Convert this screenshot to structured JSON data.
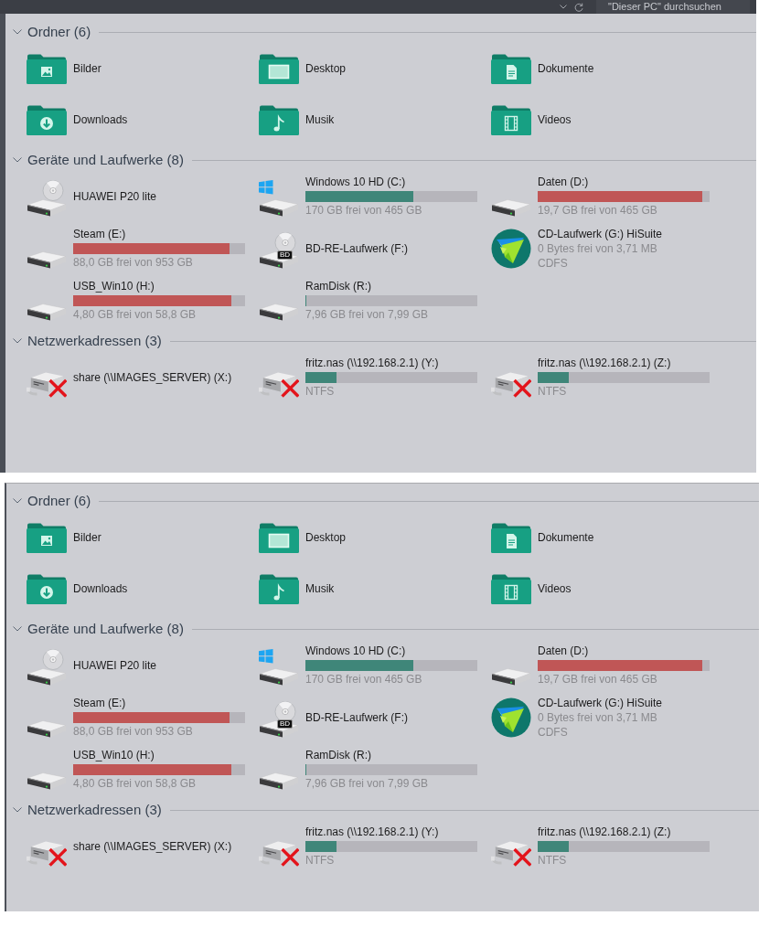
{
  "panels": [
    {
      "toolbar": {
        "search": {
          "placeholder": "\"Dieser PC\" durchsuchen"
        }
      },
      "groups": [
        {
          "title": "Ordner (6)",
          "expanded": true,
          "items": [
            {
              "kind": "pictures",
              "name": "Bilder"
            },
            {
              "kind": "desktop",
              "name": "Desktop"
            },
            {
              "kind": "documents",
              "name": "Dokumente"
            },
            {
              "kind": "downloads",
              "name": "Downloads"
            },
            {
              "kind": "music",
              "name": "Musik"
            },
            {
              "kind": "videos",
              "name": "Videos"
            }
          ]
        },
        {
          "title": "Geräte und Laufwerke (8)",
          "expanded": true,
          "items": [
            {
              "kind": "phone",
              "name": "HUAWEI P20 lite"
            },
            {
              "kind": "system",
              "name": "Windows 10 HD (C:)",
              "level": 0.63,
              "low_space": false,
              "free": "170 GB frei von 465 GB"
            },
            {
              "kind": "disk",
              "name": "Daten (D:)",
              "level": 0.96,
              "low_space": true,
              "free": "19,7 GB frei von 465 GB"
            },
            {
              "kind": "disk",
              "name": "Steam (E:)",
              "level": 0.91,
              "low_space": true,
              "free": "88,0 GB frei von 953 GB"
            },
            {
              "kind": "bluray",
              "name": "BD-RE-Laufwerk (F:)",
              "badge": "BD"
            },
            {
              "kind": "autorun",
              "name": "CD-Laufwerk (G:) HiSuite",
              "free": "0 Bytes frei von 3,71 MB",
              "filesystem": "CDFS"
            },
            {
              "kind": "disk",
              "name": "USB_Win10 (H:)",
              "level": 0.92,
              "low_space": true,
              "free": "4,80 GB frei von 58,8 GB"
            },
            {
              "kind": "disk",
              "name": "RamDisk (R:)",
              "level": 0.004,
              "low_space": false,
              "free": "7,96 GB frei von 7,99 GB"
            }
          ]
        },
        {
          "title": "Netzwerkadressen (3)",
          "expanded": true,
          "items": [
            {
              "kind": "netdrive",
              "name": "share (\\\\IMAGES_SERVER) (X:)",
              "disconnected": true
            },
            {
              "kind": "netdrive",
              "name": "fritz.nas (\\\\192.168.2.1) (Y:)",
              "disconnected": true,
              "level": 0.18,
              "low_space": false,
              "filesystem": "NTFS"
            },
            {
              "kind": "netdrive",
              "name": "fritz.nas (\\\\192.168.2.1) (Z:)",
              "disconnected": true,
              "level": 0.18,
              "low_space": false,
              "filesystem": "NTFS"
            }
          ]
        }
      ]
    },
    {
      "groups": [
        {
          "title": "Ordner (6)",
          "expanded": true,
          "items": [
            {
              "kind": "pictures",
              "name": "Bilder"
            },
            {
              "kind": "desktop",
              "name": "Desktop"
            },
            {
              "kind": "documents",
              "name": "Dokumente"
            },
            {
              "kind": "downloads",
              "name": "Downloads"
            },
            {
              "kind": "music",
              "name": "Musik"
            },
            {
              "kind": "videos",
              "name": "Videos"
            }
          ]
        },
        {
          "title": "Geräte und Laufwerke (8)",
          "expanded": true,
          "items": [
            {
              "kind": "phone",
              "name": "HUAWEI P20 lite"
            },
            {
              "kind": "system",
              "name": "Windows 10 HD (C:)",
              "level": 0.63,
              "low_space": false,
              "free": "170 GB frei von 465 GB"
            },
            {
              "kind": "disk",
              "name": "Daten (D:)",
              "level": 0.96,
              "low_space": true,
              "free": "19,7 GB frei von 465 GB"
            },
            {
              "kind": "disk",
              "name": "Steam (E:)",
              "level": 0.91,
              "low_space": true,
              "free": "88,0 GB frei von 953 GB"
            },
            {
              "kind": "bluray",
              "name": "BD-RE-Laufwerk (F:)",
              "badge": "BD"
            },
            {
              "kind": "autorun",
              "name": "CD-Laufwerk (G:) HiSuite",
              "free": "0 Bytes frei von 3,71 MB",
              "filesystem": "CDFS"
            },
            {
              "kind": "disk",
              "name": "USB_Win10 (H:)",
              "level": 0.92,
              "low_space": true,
              "free": "4,80 GB frei von 58,8 GB"
            },
            {
              "kind": "disk",
              "name": "RamDisk (R:)",
              "level": 0.004,
              "low_space": false,
              "free": "7,96 GB frei von 7,99 GB"
            }
          ]
        },
        {
          "title": "Netzwerkadressen (3)",
          "expanded": true,
          "items": [
            {
              "kind": "netdrive",
              "name": "share (\\\\IMAGES_SERVER) (X:)",
              "disconnected": true
            },
            {
              "kind": "netdrive",
              "name": "fritz.nas (\\\\192.168.2.1) (Y:)",
              "disconnected": true,
              "level": 0.18,
              "low_space": false,
              "filesystem": "NTFS"
            },
            {
              "kind": "netdrive",
              "name": "fritz.nas (\\\\192.168.2.1) (Z:)",
              "disconnected": true,
              "level": 0.18,
              "low_space": false,
              "filesystem": "NTFS"
            }
          ]
        }
      ]
    }
  ]
}
